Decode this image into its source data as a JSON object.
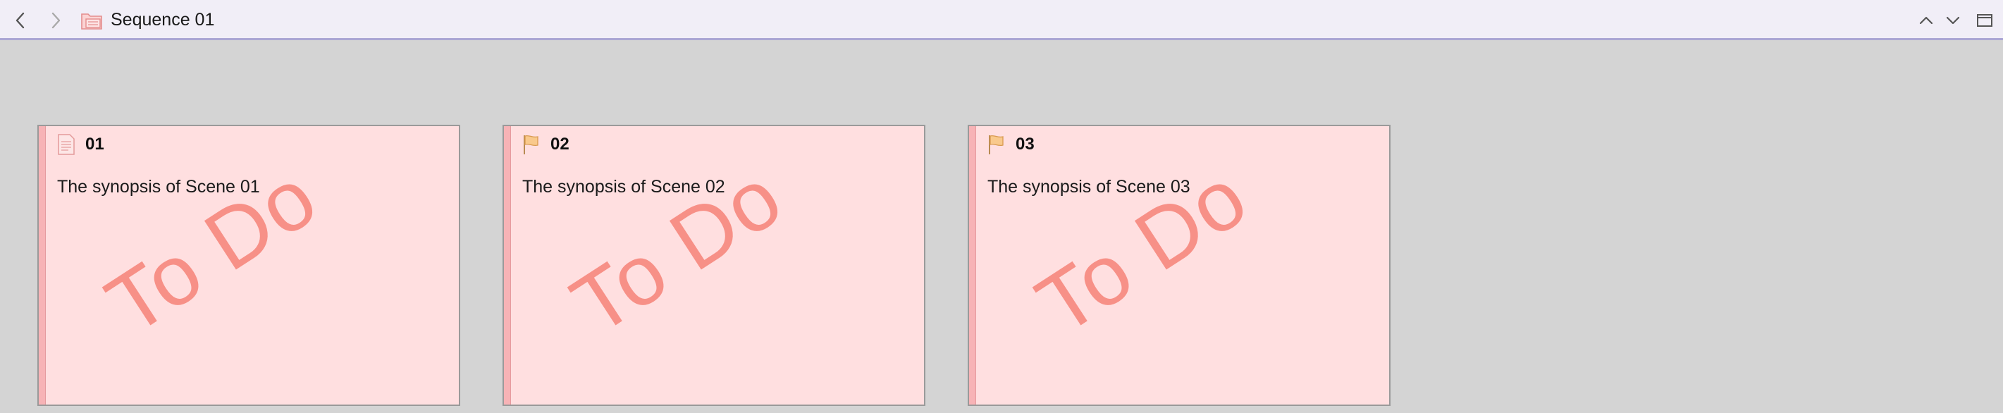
{
  "header": {
    "back_icon": "chevron-left-icon",
    "forward_icon": "chevron-right-icon",
    "folder_icon": "folder-icon",
    "title": "Sequence 01",
    "up_icon": "chevron-up-icon",
    "down_icon": "chevron-down-icon",
    "maximize_icon": "maximize-icon"
  },
  "cards": [
    {
      "title": "01",
      "synopsis": "The synopsis of Scene 01",
      "stamp": "To Do",
      "icon": "document-icon"
    },
    {
      "title": "02",
      "synopsis": "The synopsis of Scene 02",
      "stamp": "To Do",
      "icon": "flag-icon"
    },
    {
      "title": "03",
      "synopsis": "The synopsis of Scene 03",
      "stamp": "To Do",
      "icon": "flag-icon"
    }
  ],
  "colors": {
    "card_background": "#ffdfe0",
    "stamp": "#f79087",
    "header_border": "#aba6d4"
  }
}
